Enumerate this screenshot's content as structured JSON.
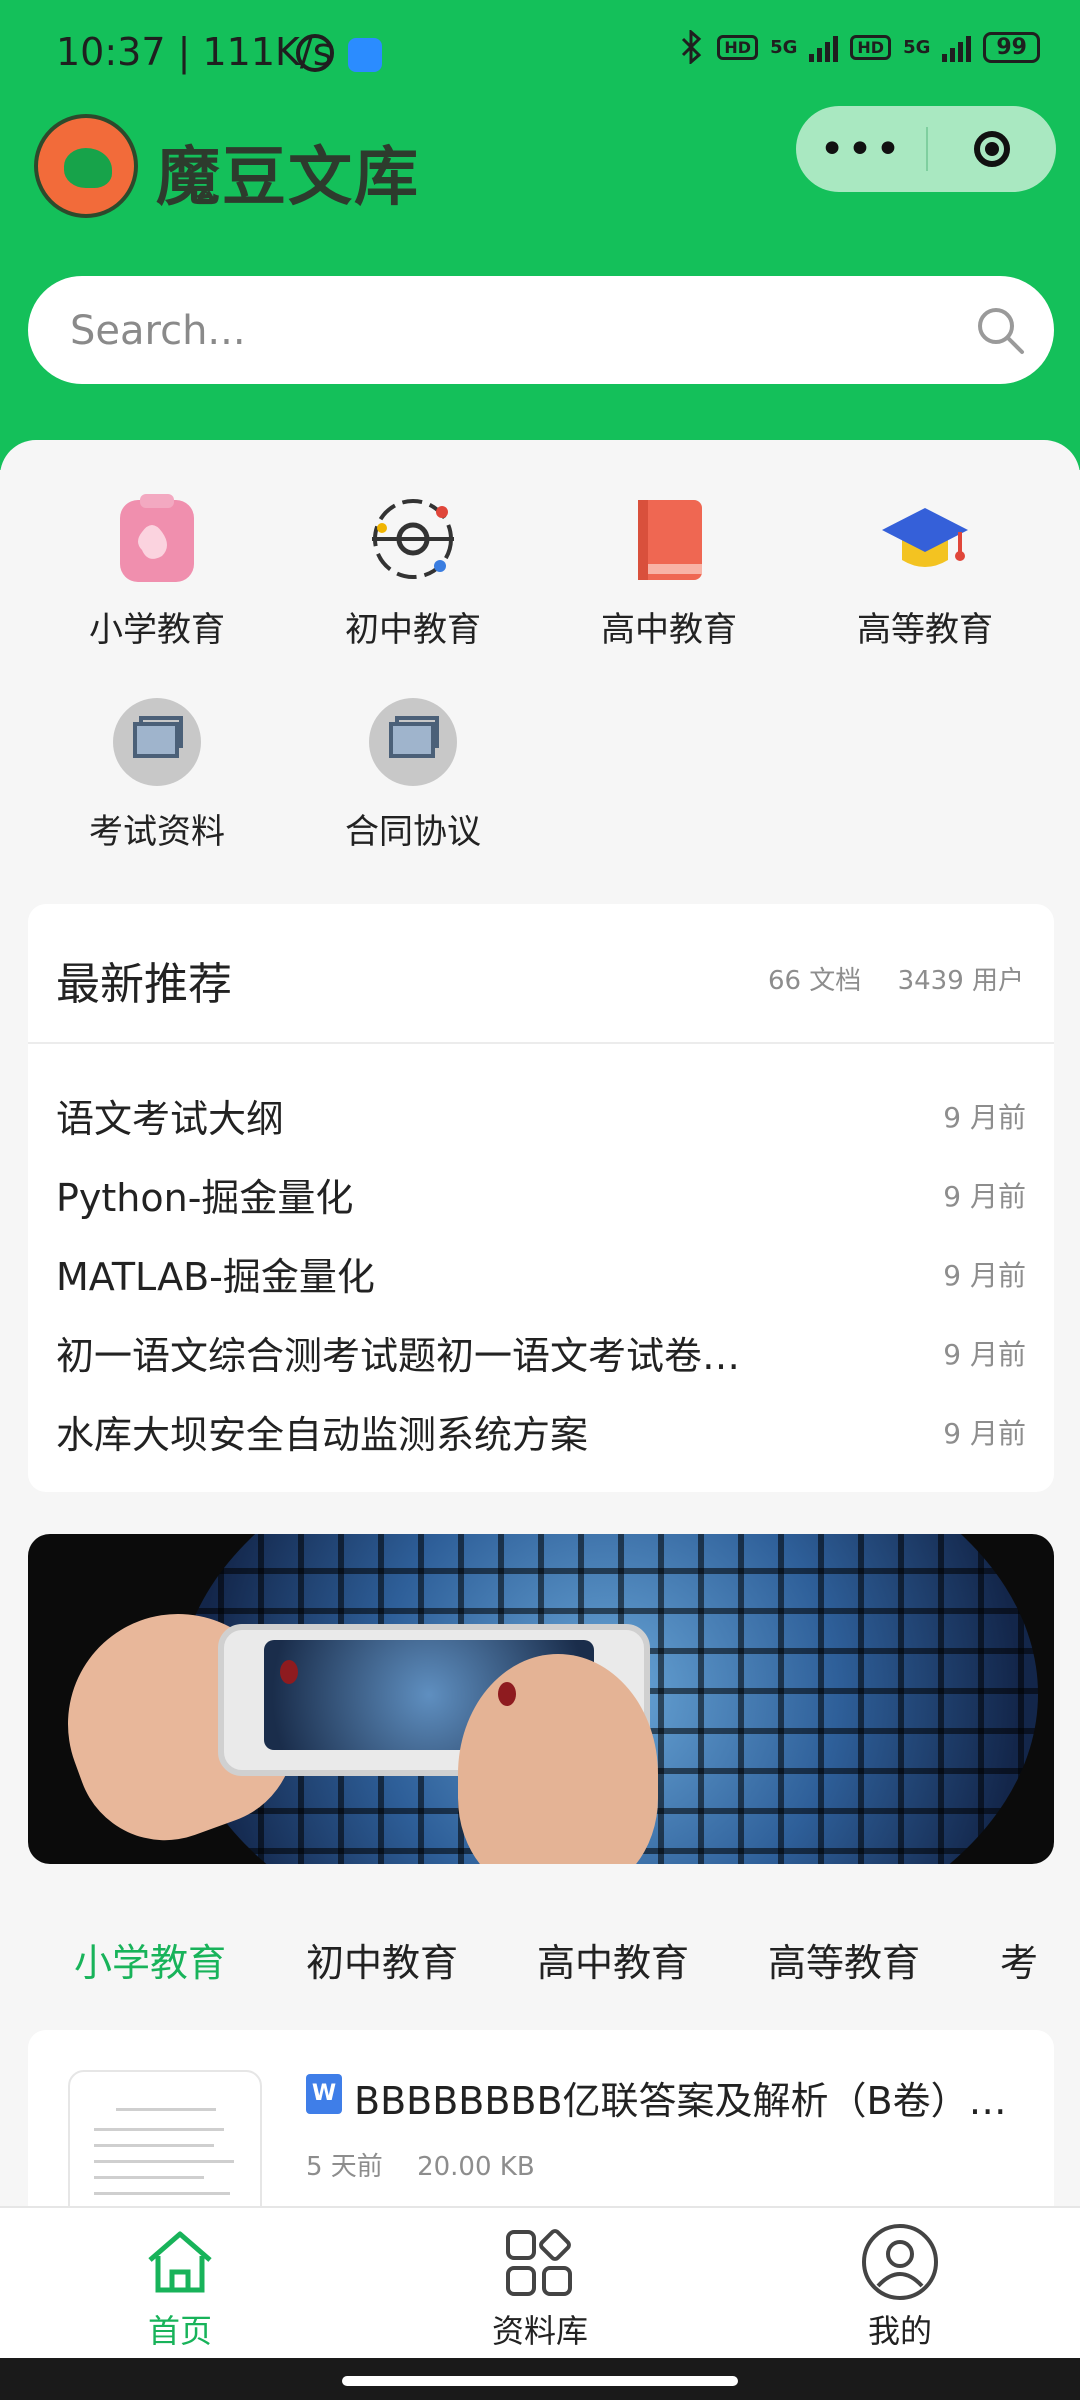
{
  "status_bar": {
    "time_speed": "10:37 | 111K/s",
    "network_a": "5G",
    "network_b": "5G",
    "hd_a": "HD",
    "hd_b": "HD",
    "battery": "99"
  },
  "header": {
    "app_name": "魔豆文库",
    "capsule_more": "•••",
    "brand_color": "#14c05a"
  },
  "search": {
    "placeholder": "Search...",
    "value": ""
  },
  "categories": [
    {
      "label": "小学教育",
      "icon": "clipboard-icon"
    },
    {
      "label": "初中教育",
      "icon": "orbit-icon"
    },
    {
      "label": "高中教育",
      "icon": "book-icon"
    },
    {
      "label": "高等教育",
      "icon": "graduation-cap-icon"
    },
    {
      "label": "考试资料",
      "icon": "image-placeholder-icon"
    },
    {
      "label": "合同协议",
      "icon": "image-placeholder-icon"
    }
  ],
  "recommend": {
    "title": "最新推荐",
    "doc_count": "66 文档",
    "user_count": "3439 用户",
    "items": [
      {
        "title": "语文考试大纲",
        "time": "9 月前"
      },
      {
        "title": "Python-掘金量化",
        "time": "9 月前"
      },
      {
        "title": "MATLAB-掘金量化",
        "time": "9 月前"
      },
      {
        "title": "初一语文综合测考试题初一语文考试卷…",
        "time": "9 月前"
      },
      {
        "title": "水库大坝安全自动监测系统方案",
        "time": "9 月前"
      }
    ]
  },
  "tabs": [
    "小学教育",
    "初中教育",
    "高中教育",
    "高等教育",
    "考"
  ],
  "doc": {
    "type_badge": "W",
    "title": "BBBBBBBB亿联答案及解析（B卷）…",
    "time": "5 天前",
    "size": "20.00 KB"
  },
  "bottom_nav": {
    "home": "首页",
    "library": "资料库",
    "mine": "我的"
  }
}
